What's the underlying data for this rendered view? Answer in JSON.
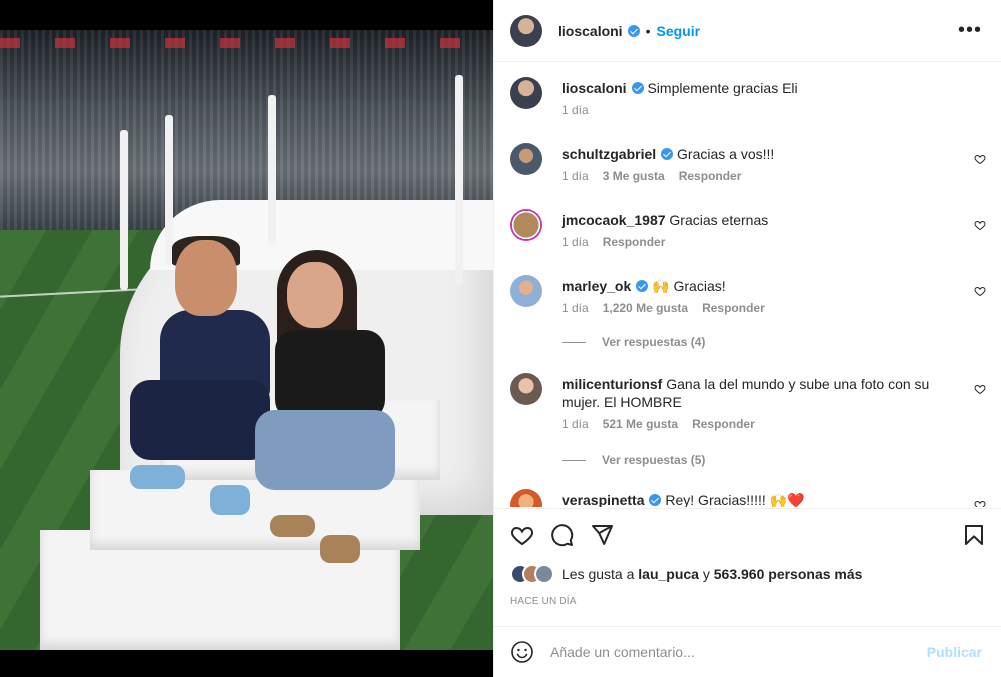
{
  "post": {
    "author": "lioscaloni",
    "follow_label": "Seguir",
    "dot": "•",
    "more_icon": "more-horizontal-icon"
  },
  "caption": {
    "username": "lioscaloni",
    "text": "Simplemente gracias Eli",
    "time": "1 día"
  },
  "comments": [
    {
      "username": "schultzgabriel",
      "verified": true,
      "text": "Gracias a vos!!!",
      "time": "1 día",
      "likes": "3 Me gusta",
      "reply": "Responder",
      "avatar_color": "#4a5a6a"
    },
    {
      "username": "jmcocaok_1987",
      "verified": false,
      "text": "Gracias eternas",
      "time": "1 día",
      "likes": "",
      "reply": "Responder",
      "avatar_color": "#b08a5a"
    },
    {
      "username": "marley_ok",
      "verified": true,
      "text": "🙌 Gracias!",
      "time": "1 día",
      "likes": "1,220 Me gusta",
      "reply": "Responder",
      "avatar_color": "#8fb0d6",
      "replies_label": "Ver respuestas (4)"
    },
    {
      "username": "milicenturionsf",
      "verified": false,
      "text": "Gana la del mundo y sube una foto con su mujer. El HOMBRE",
      "time": "1 día",
      "likes": "521 Me gusta",
      "reply": "Responder",
      "avatar_color": "#c9a793",
      "replies_label": "Ver respuestas (5)"
    },
    {
      "username": "veraspinetta",
      "verified": true,
      "text": "Rey! Gracias!!!!! 🙌❤️",
      "avatar_color": "#d45a2a"
    }
  ],
  "likes": {
    "prefix": "Les gusta a",
    "user": "lau_puca",
    "connector": "y",
    "count_text": "563.960 personas más"
  },
  "time_ago": "HACE UN DÍA",
  "comment_box": {
    "placeholder": "Añade un comentario...",
    "publish_label": "Publicar"
  },
  "colors": {
    "accent": "#0095f6",
    "verified": "#3897f0",
    "muted": "#8e8e8e",
    "publish_disabled": "#b2dffc"
  }
}
